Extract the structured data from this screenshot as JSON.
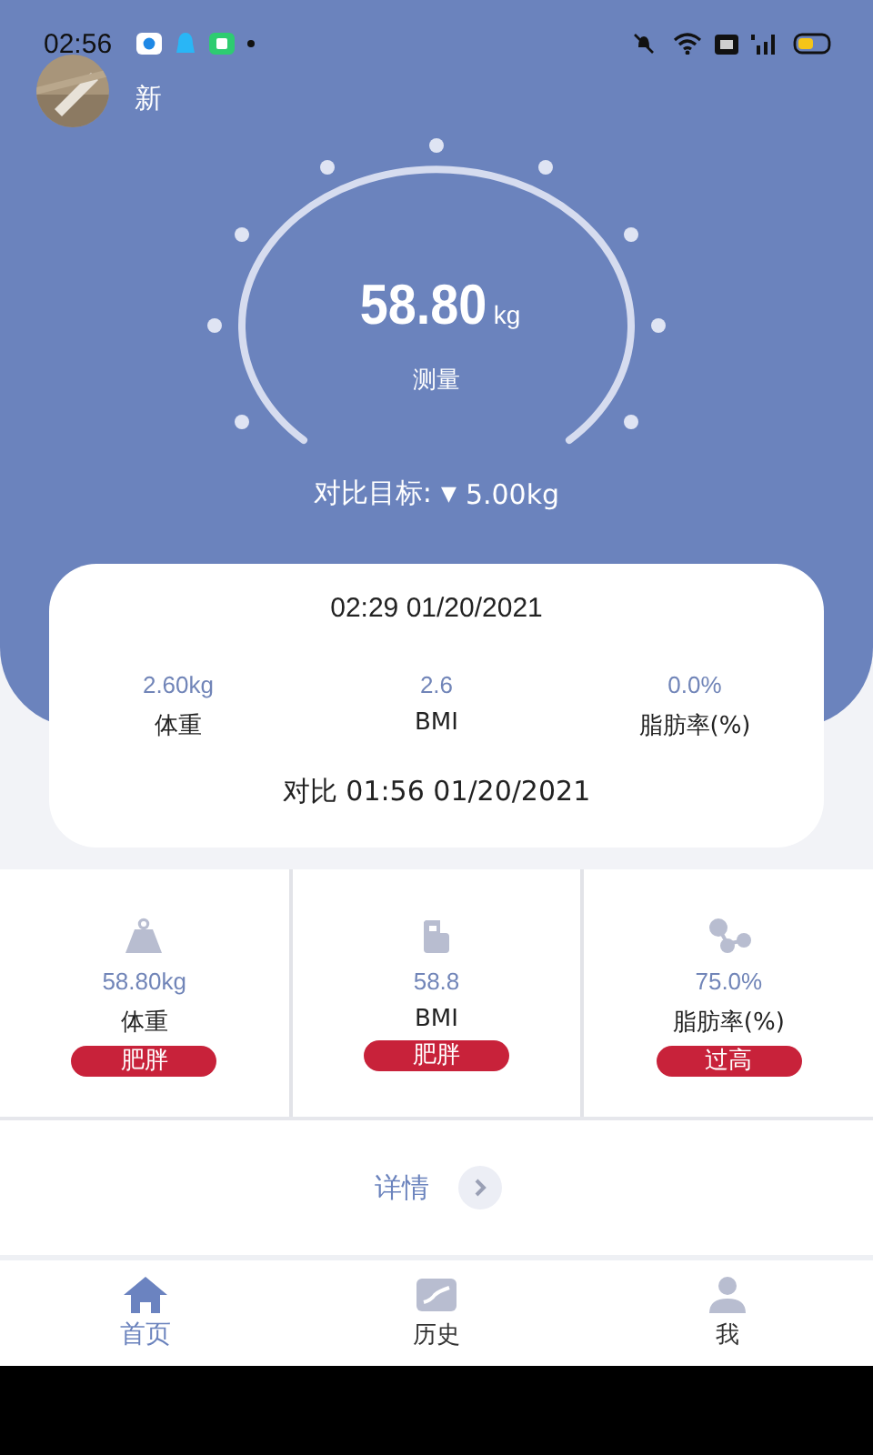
{
  "status_bar": {
    "time": "02:56"
  },
  "user": {
    "name": "新"
  },
  "gauge": {
    "value": "58.80",
    "unit": "kg",
    "label": "测量"
  },
  "target": {
    "label": "对比目标:",
    "arrow": "▼",
    "value": "5.00kg"
  },
  "comparison": {
    "date": "02:29 01/20/2021",
    "metrics": [
      {
        "value": "2.60kg",
        "label": "体重"
      },
      {
        "value": "2.6",
        "label": "BMI"
      },
      {
        "value": "0.0%",
        "label": "脂肪率(%)"
      }
    ],
    "footer": "对比 01:56 01/20/2021"
  },
  "stats": [
    {
      "kind": "weight",
      "value": "58.80kg",
      "label": "体重",
      "badge": "肥胖"
    },
    {
      "kind": "bmi",
      "value": "58.8",
      "label": "BMI",
      "badge": "肥胖"
    },
    {
      "kind": "fat",
      "value": "75.0%",
      "label": "脂肪率(%)",
      "badge": "过高"
    }
  ],
  "details": {
    "label": "详情"
  },
  "tabs": [
    {
      "kind": "home",
      "label": "首页",
      "selected": true
    },
    {
      "kind": "history",
      "label": "历史",
      "selected": false
    },
    {
      "kind": "me",
      "label": "我",
      "selected": false
    }
  ]
}
